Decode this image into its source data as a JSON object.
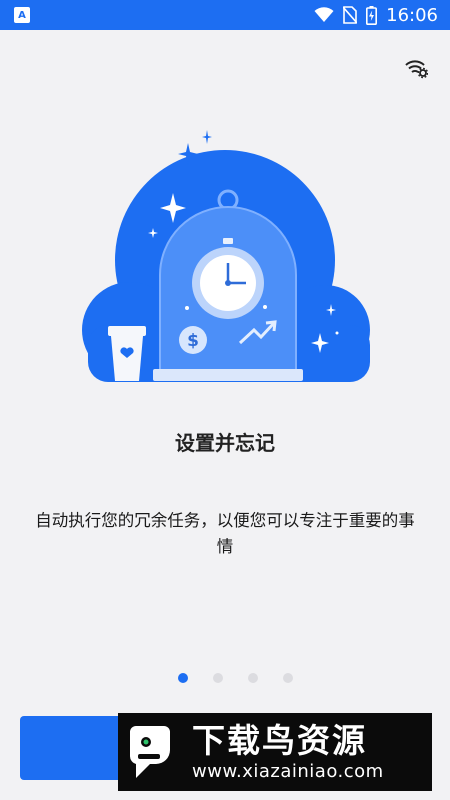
{
  "status_bar": {
    "time": "16:06",
    "icons": [
      "app-notification-icon",
      "wifi-icon",
      "no-sim-icon",
      "battery-charging-icon"
    ]
  },
  "top_action": {
    "icon": "wifi-settings-icon"
  },
  "onboarding": {
    "title": "设置并忘记",
    "description": "自动执行您的冗余任务，以便您可以专注于重要的事情",
    "page_count": 4,
    "active_page": 1
  },
  "primary_button": {
    "label": ""
  },
  "watermark": {
    "title": "下载鸟资源",
    "url": "www.xiazainiao.com"
  },
  "colors": {
    "accent": "#1d6ef2",
    "background": "#f2f2f4",
    "text": "#1a1a1a",
    "dot_inactive": "#dcdce0"
  }
}
